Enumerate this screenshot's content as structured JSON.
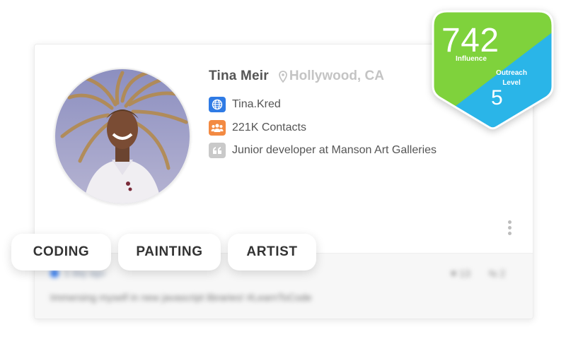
{
  "profile": {
    "name": "Tina Meir",
    "location": "Hollywood, CA",
    "website": "Tina.Kred",
    "contacts": "221K Contacts",
    "bio": "Junior developer at Manson Art Galleries"
  },
  "tags": [
    "CODING",
    "PAINTING",
    "ARTIST"
  ],
  "post": {
    "time": "1 day ago",
    "likes": "13",
    "shares": "2",
    "text": "Immersing myself in new javascript libraries! #LearnToCode"
  },
  "badge": {
    "influence_score": "742",
    "influence_label": "Influence",
    "outreach_label": "Outreach Level",
    "outreach_level": "5"
  },
  "colors": {
    "badge_green": "#7fd23c",
    "badge_blue": "#2ab5e8",
    "website_icon": "#2f7be5",
    "contacts_icon": "#f38a42",
    "quote_icon": "#c9c9c9"
  },
  "icons": {
    "location": "location-pin-icon",
    "website": "globe-icon",
    "contacts": "people-icon",
    "bio": "quote-icon",
    "more": "more-vertical-icon"
  }
}
